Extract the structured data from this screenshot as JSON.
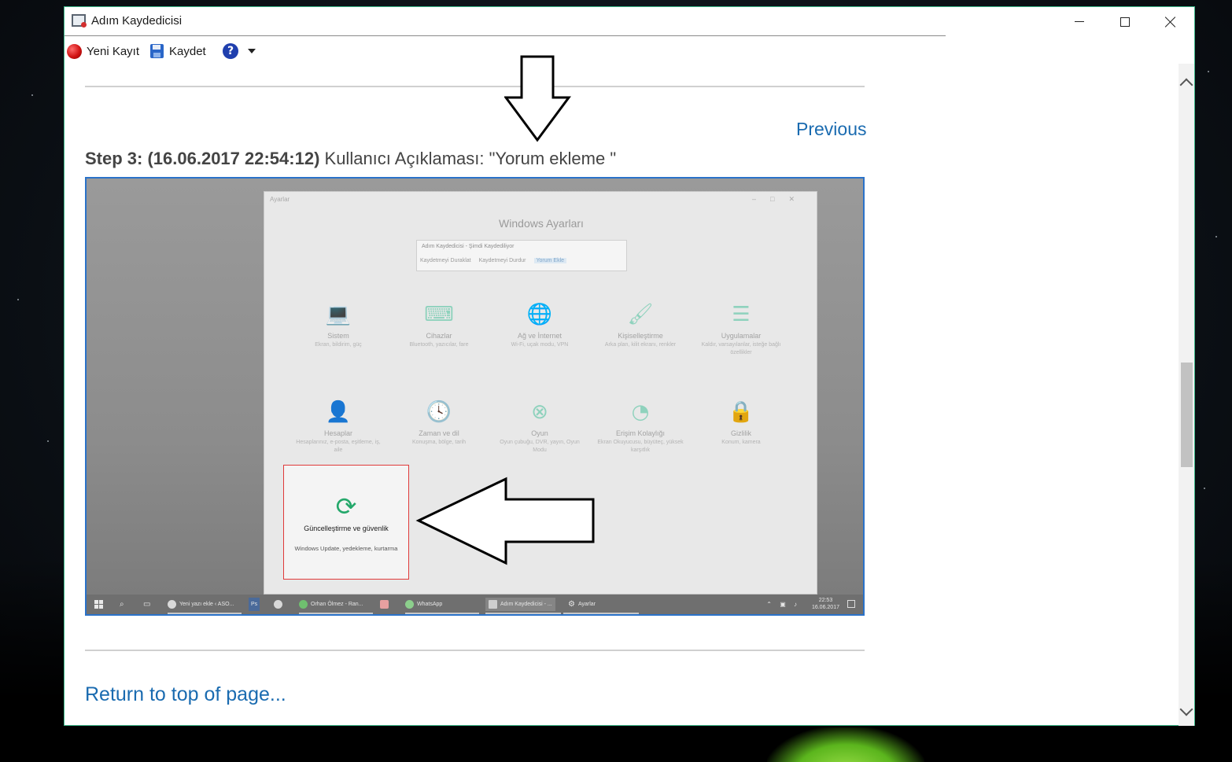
{
  "window": {
    "title": "Adım Kaydedicisi"
  },
  "toolbar": {
    "new_label": "Yeni Kayıt",
    "save_label": "Kaydet",
    "help_glyph": "?"
  },
  "page": {
    "previous_link": "Previous",
    "step_bold": "Step 3: (16.06.2017 22:54:12)",
    "step_desc": " Kullanıcı Açıklaması: \"Yorum ekleme \"",
    "return_link": "Return to top of page..."
  },
  "screenshot": {
    "settings_title": "Ayarlar",
    "settings_heading": "Windows Ayarları",
    "recorder": {
      "title": "Adım Kaydedicisi - Şimdi Kaydediliyor",
      "pause": "Kaydetmeyi Duraklat",
      "stop": "Kaydetmeyi Durdur",
      "comment": "Yorum Ekle"
    },
    "tiles": [
      {
        "icon": "laptop-icon",
        "glyph": "💻",
        "name": "Sistem",
        "desc": "Ekran, bildirim, güç"
      },
      {
        "icon": "devices-icon",
        "glyph": "⌨",
        "name": "Cihazlar",
        "desc": "Bluetooth, yazıcılar, fare"
      },
      {
        "icon": "globe-icon",
        "glyph": "🌐",
        "name": "Ağ ve İnternet",
        "desc": "Wi-Fi, uçak modu, VPN"
      },
      {
        "icon": "personalization-icon",
        "glyph": "🖌",
        "name": "Kişiselleştirme",
        "desc": "Arka plan, kilit ekranı, renkler"
      },
      {
        "icon": "apps-icon",
        "glyph": "☰",
        "name": "Uygulamalar",
        "desc": "Kaldır, varsayılanlar, isteğe bağlı özellikler"
      },
      {
        "icon": "accounts-icon",
        "glyph": "👤",
        "name": "Hesaplar",
        "desc": "Hesaplarınız, e-posta, eşitleme, iş, aile"
      },
      {
        "icon": "time-language-icon",
        "glyph": "🕓",
        "name": "Zaman ve dil",
        "desc": "Konuşma, bölge, tarih"
      },
      {
        "icon": "xbox-icon",
        "glyph": "⊗",
        "name": "Oyun",
        "desc": "Oyun çubuğu, DVR, yayın, Oyun Modu"
      },
      {
        "icon": "ease-of-access-icon",
        "glyph": "◔",
        "name": "Erişim Kolaylığı",
        "desc": "Ekran Okuyucusu, büyüteç, yüksek karşıtlık"
      },
      {
        "icon": "lock-icon",
        "glyph": "🔒",
        "name": "Gizlilik",
        "desc": "Konum, kamera"
      }
    ],
    "highlight": {
      "glyph": "⟳",
      "name": "Güncelleştirme ve güvenlik",
      "desc": "Windows Update, yedekleme, kurtarma"
    },
    "taskbar": {
      "tasks": [
        "Yeni yazı ekle ‹ ASO...",
        "Ps",
        "Orhan Ölmez - Ran...",
        "WhatsApp",
        "Adım Kaydedicisi - ...",
        "Ayarlar"
      ],
      "time": "22:53",
      "date": "16.06.2017"
    }
  },
  "colors": {
    "accent": "#2a72c9",
    "link": "#1a6bb0",
    "window_border": "#3db88a",
    "highlight_border": "#e03a3a",
    "tile_icon": "#8fd2bd"
  }
}
